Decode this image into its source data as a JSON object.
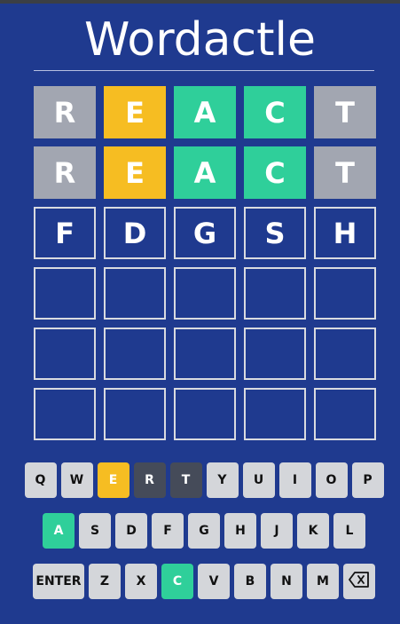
{
  "title": "Wordactle",
  "board": [
    [
      {
        "letter": "R",
        "state": "absent"
      },
      {
        "letter": "E",
        "state": "present"
      },
      {
        "letter": "A",
        "state": "correct"
      },
      {
        "letter": "C",
        "state": "correct"
      },
      {
        "letter": "T",
        "state": "absent"
      }
    ],
    [
      {
        "letter": "R",
        "state": "absent"
      },
      {
        "letter": "E",
        "state": "present"
      },
      {
        "letter": "A",
        "state": "correct"
      },
      {
        "letter": "C",
        "state": "correct"
      },
      {
        "letter": "T",
        "state": "absent"
      }
    ],
    [
      {
        "letter": "F",
        "state": "empty"
      },
      {
        "letter": "D",
        "state": "empty"
      },
      {
        "letter": "G",
        "state": "empty"
      },
      {
        "letter": "S",
        "state": "empty"
      },
      {
        "letter": "H",
        "state": "empty"
      }
    ],
    [
      {
        "letter": "",
        "state": "empty"
      },
      {
        "letter": "",
        "state": "empty"
      },
      {
        "letter": "",
        "state": "empty"
      },
      {
        "letter": "",
        "state": "empty"
      },
      {
        "letter": "",
        "state": "empty"
      }
    ],
    [
      {
        "letter": "",
        "state": "empty"
      },
      {
        "letter": "",
        "state": "empty"
      },
      {
        "letter": "",
        "state": "empty"
      },
      {
        "letter": "",
        "state": "empty"
      },
      {
        "letter": "",
        "state": "empty"
      }
    ],
    [
      {
        "letter": "",
        "state": "empty"
      },
      {
        "letter": "",
        "state": "empty"
      },
      {
        "letter": "",
        "state": "empty"
      },
      {
        "letter": "",
        "state": "empty"
      },
      {
        "letter": "",
        "state": "empty"
      }
    ]
  ],
  "keyboard": {
    "rows": [
      [
        {
          "label": "Q",
          "state": "unused"
        },
        {
          "label": "W",
          "state": "unused"
        },
        {
          "label": "E",
          "state": "present"
        },
        {
          "label": "R",
          "state": "absent"
        },
        {
          "label": "T",
          "state": "absent"
        },
        {
          "label": "Y",
          "state": "unused"
        },
        {
          "label": "U",
          "state": "unused"
        },
        {
          "label": "I",
          "state": "unused"
        },
        {
          "label": "O",
          "state": "unused"
        },
        {
          "label": "P",
          "state": "unused"
        }
      ],
      [
        {
          "label": "A",
          "state": "correct"
        },
        {
          "label": "S",
          "state": "unused"
        },
        {
          "label": "D",
          "state": "unused"
        },
        {
          "label": "F",
          "state": "unused"
        },
        {
          "label": "G",
          "state": "unused"
        },
        {
          "label": "H",
          "state": "unused"
        },
        {
          "label": "J",
          "state": "unused"
        },
        {
          "label": "K",
          "state": "unused"
        },
        {
          "label": "L",
          "state": "unused"
        }
      ],
      [
        {
          "label": "ENTER",
          "state": "unused"
        },
        {
          "label": "Z",
          "state": "unused"
        },
        {
          "label": "X",
          "state": "unused"
        },
        {
          "label": "C",
          "state": "correct"
        },
        {
          "label": "V",
          "state": "unused"
        },
        {
          "label": "B",
          "state": "unused"
        },
        {
          "label": "N",
          "state": "unused"
        },
        {
          "label": "M",
          "state": "unused"
        },
        {
          "label": "",
          "state": "unused",
          "icon": "backspace-icon"
        }
      ]
    ]
  },
  "colors": {
    "background": "#1f3a8f",
    "correct": "#2fcf9a",
    "present": "#f6bd22",
    "absent_tile": "#a2a6b1",
    "absent_key": "#454b59",
    "key_default": "#d4d6da"
  }
}
